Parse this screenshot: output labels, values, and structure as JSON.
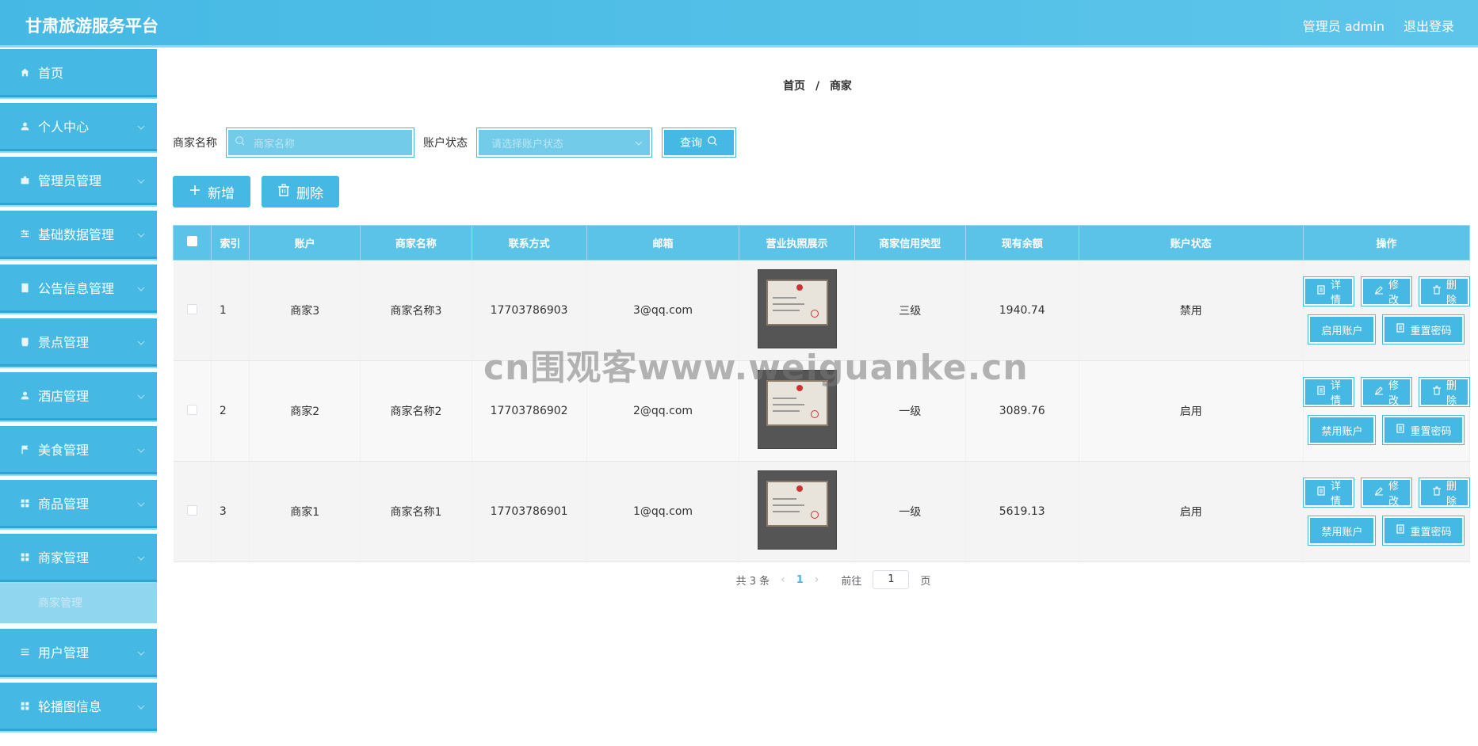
{
  "header": {
    "title": "甘肃旅游服务平台",
    "user": "管理员 admin",
    "logout": "退出登录"
  },
  "sidebar": {
    "items": [
      {
        "label": "首页",
        "icon": "home-icon"
      },
      {
        "label": "个人中心",
        "icon": "user-icon"
      },
      {
        "label": "管理员管理",
        "icon": "briefcase-icon"
      },
      {
        "label": "基础数据管理",
        "icon": "sliders-icon"
      },
      {
        "label": "公告信息管理",
        "icon": "document-icon"
      },
      {
        "label": "景点管理",
        "icon": "box-icon"
      },
      {
        "label": "酒店管理",
        "icon": "user-icon"
      },
      {
        "label": "美食管理",
        "icon": "flag-icon"
      },
      {
        "label": "商品管理",
        "icon": "grid-icon"
      },
      {
        "label": "商家管理",
        "icon": "grid-icon"
      },
      {
        "label": "用户管理",
        "icon": "list-icon"
      },
      {
        "label": "轮播图信息",
        "icon": "grid-icon"
      }
    ],
    "active_sub": "商家管理"
  },
  "breadcrumb": {
    "home": "首页",
    "separator": "/",
    "current": "商家"
  },
  "search": {
    "name_label": "商家名称",
    "name_placeholder": "商家名称",
    "status_label": "账户状态",
    "status_placeholder": "请选择账户状态",
    "query_label": "查询"
  },
  "actions": {
    "add_label": "新增",
    "delete_label": "删除"
  },
  "table": {
    "headers": [
      "索引",
      "账户",
      "商家名称",
      "联系方式",
      "邮箱",
      "营业执照展示",
      "商家信用类型",
      "现有余额",
      "账户状态",
      "操作"
    ],
    "rows": [
      {
        "index": "1",
        "account": "商家3",
        "name": "商家名称3",
        "phone": "17703786903",
        "email": "3@qq.com",
        "credit": "三级",
        "balance": "1940.74",
        "status": "禁用",
        "toggle_label": "启用账户"
      },
      {
        "index": "2",
        "account": "商家2",
        "name": "商家名称2",
        "phone": "17703786902",
        "email": "2@qq.com",
        "credit": "一级",
        "balance": "3089.76",
        "status": "启用",
        "toggle_label": "禁用账户"
      },
      {
        "index": "3",
        "account": "商家1",
        "name": "商家名称1",
        "phone": "17703786901",
        "email": "1@qq.com",
        "credit": "一级",
        "balance": "5619.13",
        "status": "启用",
        "toggle_label": "禁用账户"
      }
    ],
    "op_labels": {
      "detail": "详情",
      "edit": "修改",
      "delete": "删除",
      "reset": "重置密码"
    }
  },
  "pagination": {
    "total": "共 3 条",
    "current_page": "1",
    "goto_label": "前往",
    "goto_value": "1",
    "page_unit": "页"
  },
  "watermark": "cn围观客www.weiguanke.cn",
  "colors": {
    "accent": "#45b9e4",
    "header": "#5ec5ea"
  }
}
